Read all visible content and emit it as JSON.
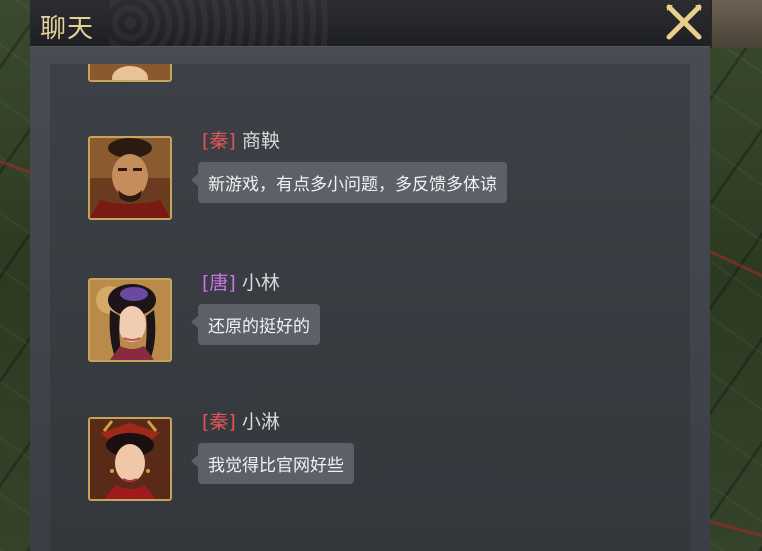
{
  "window": {
    "title": "聊天"
  },
  "colors": {
    "title": "#e6cf99",
    "faction_qin": "#e0555a",
    "faction_tang": "#c775e8",
    "name": "#d9d9d9",
    "bubble_bg": "#5d6068"
  },
  "messages": [
    {
      "faction": "[秦]",
      "faction_color": "#e0555a",
      "name": "商鞅",
      "text": "新游戏，有点多小问题，多反馈多体谅",
      "avatar": "avatar-male-warrior"
    },
    {
      "faction": "[唐]",
      "faction_color": "#c775e8",
      "name": "小林",
      "text": "还原的挺好的",
      "avatar": "avatar-female-noble"
    },
    {
      "faction": "[秦]",
      "faction_color": "#e0555a",
      "name": "小淋",
      "text": "我觉得比官网好些",
      "avatar": "avatar-female-queen"
    }
  ]
}
